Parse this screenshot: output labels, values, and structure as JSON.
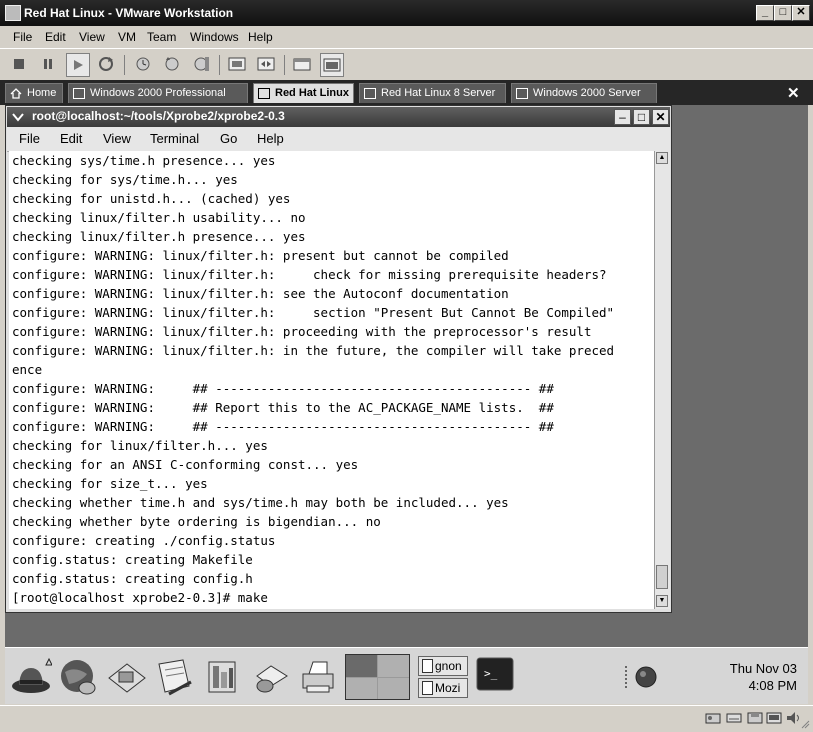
{
  "vmware": {
    "title": "Red Hat Linux - VMware Workstation",
    "menu": [
      "File",
      "Edit",
      "View",
      "VM",
      "Team",
      "Windows",
      "Help"
    ],
    "tabs": [
      {
        "label": "Home",
        "active": false
      },
      {
        "label": "Windows 2000 Professional",
        "active": false
      },
      {
        "label": "Red Hat Linux",
        "active": true
      },
      {
        "label": "Red Hat Linux 8 Server",
        "active": false
      },
      {
        "label": "Windows 2000 Server",
        "active": false
      }
    ]
  },
  "terminal": {
    "title": "root@localhost:~/tools/Xprobe2/xprobe2-0.3",
    "menu": [
      "File",
      "Edit",
      "View",
      "Terminal",
      "Go",
      "Help"
    ],
    "lines": [
      "checking sys/time.h presence... yes",
      "checking for sys/time.h... yes",
      "checking for unistd.h... (cached) yes",
      "checking linux/filter.h usability... no",
      "checking linux/filter.h presence... yes",
      "configure: WARNING: linux/filter.h: present but cannot be compiled",
      "configure: WARNING: linux/filter.h:     check for missing prerequisite headers?",
      "configure: WARNING: linux/filter.h: see the Autoconf documentation",
      "configure: WARNING: linux/filter.h:     section \"Present But Cannot Be Compiled\"",
      "configure: WARNING: linux/filter.h: proceeding with the preprocessor's result",
      "configure: WARNING: linux/filter.h: in the future, the compiler will take preced",
      "ence",
      "configure: WARNING:     ## ------------------------------------------ ##",
      "configure: WARNING:     ## Report this to the AC_PACKAGE_NAME lists.  ##",
      "configure: WARNING:     ## ------------------------------------------ ##",
      "checking for linux/filter.h... yes",
      "checking for an ANSI C-conforming const... yes",
      "checking for size_t... yes",
      "checking whether time.h and sys/time.h may both be included... yes",
      "checking whether byte ordering is bigendian... no",
      "configure: creating ./config.status",
      "config.status: creating Makefile",
      "config.status: creating config.h",
      "[root@localhost xprobe2-0.3]# make"
    ]
  },
  "panel": {
    "tasks": [
      "gnon",
      "Mozi"
    ],
    "clock_date": "Thu Nov 03",
    "clock_time": "4:08 PM"
  }
}
